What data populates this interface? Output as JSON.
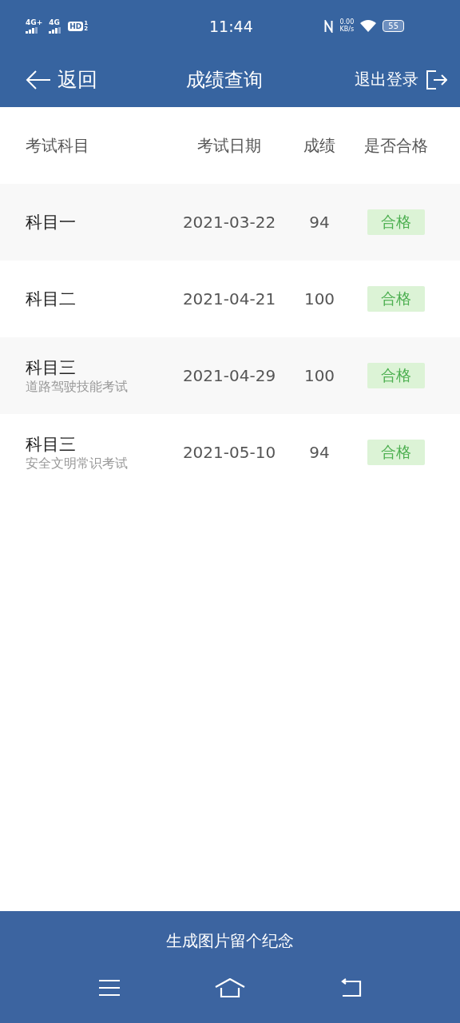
{
  "status_bar": {
    "network_1": "4G+",
    "network_2": "4G",
    "hd": "HD",
    "hd_sims": [
      "1",
      "2"
    ],
    "time": "11:44",
    "speed": "0.00",
    "speed_unit": "KB/s",
    "battery": "55"
  },
  "nav": {
    "back": "返回",
    "title": "成绩查询",
    "logout": "退出登录"
  },
  "table": {
    "columns": [
      "考试科目",
      "考试日期",
      "成绩",
      "是否合格"
    ],
    "rows": [
      {
        "subject": "科目一",
        "date": "2021-03-22",
        "score": "94",
        "result": "合格",
        "passed": true
      },
      {
        "subject": "科目二",
        "date": "2021-04-21",
        "score": "100",
        "result": "合格",
        "passed": true
      },
      {
        "subject": "科目三",
        "note": "道路驾驶技能考试",
        "date": "2021-04-29",
        "score": "100",
        "result": "合格",
        "passed": true
      },
      {
        "subject": "科目三",
        "note": "安全文明常识考试",
        "date": "2021-05-10",
        "score": "94",
        "result": "合格",
        "passed": true
      }
    ]
  },
  "footer_button": "生成图片留个纪念"
}
